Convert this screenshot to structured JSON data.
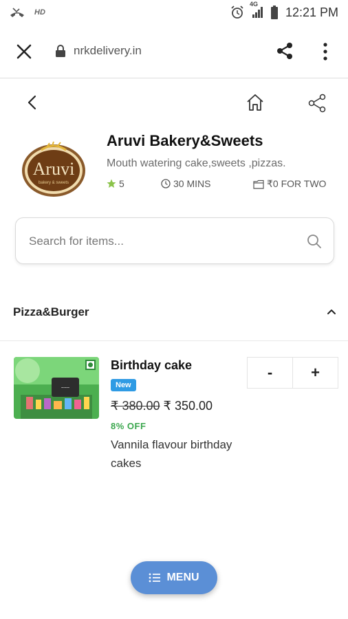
{
  "status_bar": {
    "hd": "HD",
    "network": "4G",
    "time": "12:21 PM"
  },
  "browser": {
    "url": "nrkdelivery.in"
  },
  "store": {
    "name": "Aruvi Bakery&Sweets",
    "description": "Mouth watering cake,sweets ,pizzas.",
    "rating": "5",
    "delivery_time": "30 MINS",
    "cost": "₹0 FOR TWO",
    "logo_text": "Aruvi",
    "logo_subtext": "bakery & sweets"
  },
  "search": {
    "placeholder": "Search for items..."
  },
  "category": {
    "title": "Pizza&Burger"
  },
  "item": {
    "name": "Birthday cake",
    "badge": "New",
    "old_price": "₹ 380.00",
    "price": "₹ 350.00",
    "discount": "8% OFF",
    "description": "Vannila flavour birthday cakes",
    "minus_label": "-",
    "plus_label": "+"
  },
  "menu_button": {
    "label": "MENU"
  },
  "colors": {
    "accent": "#5b8fd6",
    "badge": "#2f9be4",
    "discount": "#3aa64d",
    "rating_star": "#8bc34a"
  }
}
